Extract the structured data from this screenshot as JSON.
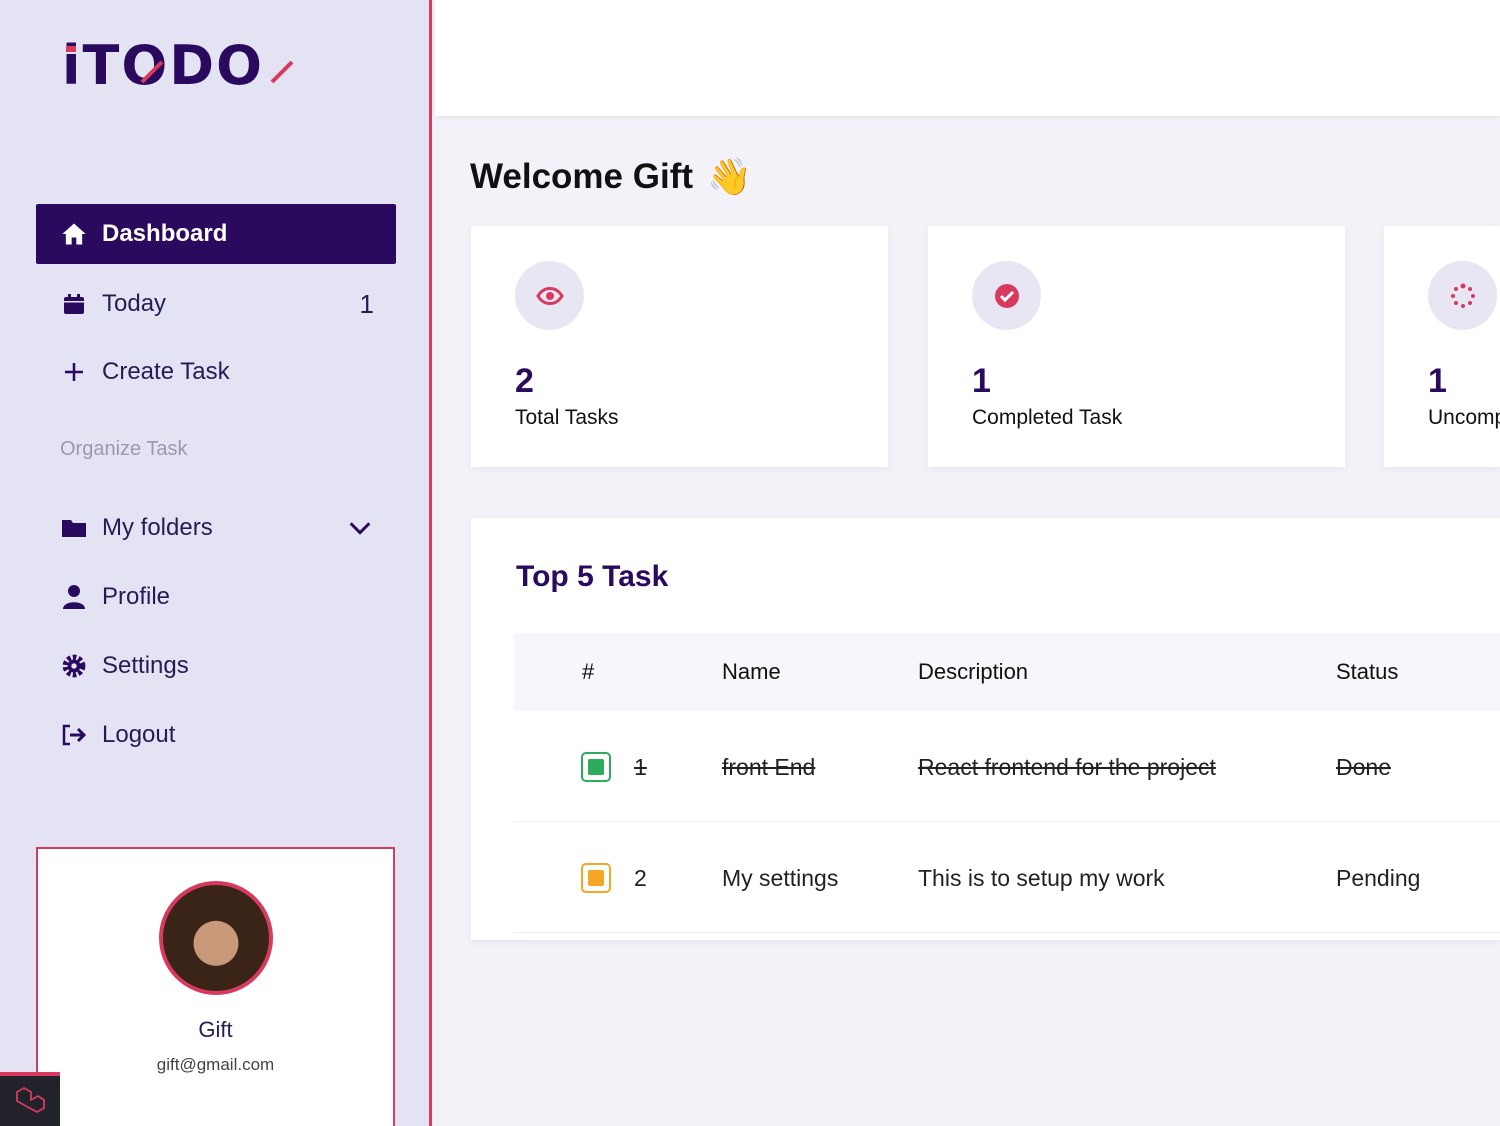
{
  "brand": {
    "logo_text": "iTODO"
  },
  "sidebar": {
    "items": [
      {
        "label": "Dashboard",
        "icon": "home-icon"
      },
      {
        "label": "Today",
        "icon": "calendar-icon",
        "badge": "1"
      },
      {
        "label": "Create Task",
        "icon": "plus-icon"
      },
      {
        "label": "My folders",
        "icon": "folder-icon"
      },
      {
        "label": "Profile",
        "icon": "user-icon"
      },
      {
        "label": "Settings",
        "icon": "gear-icon"
      },
      {
        "label": "Logout",
        "icon": "logout-icon"
      }
    ],
    "section_label": "Organize Task"
  },
  "user": {
    "name": "Gift",
    "email": "gift@gmail.com"
  },
  "main": {
    "welcome": "Welcome Gift",
    "welcome_emoji": "👋",
    "stats": [
      {
        "value": "2",
        "label": "Total Tasks",
        "icon": "eye-icon"
      },
      {
        "value": "1",
        "label": "Completed Task",
        "icon": "check-circle-icon"
      },
      {
        "value": "1",
        "label": "Uncomp",
        "icon": "spinner-icon"
      }
    ],
    "table": {
      "title": "Top 5 Task",
      "headers": [
        "#",
        "Name",
        "Description",
        "Status"
      ],
      "rows": [
        {
          "num": "1",
          "name": "front End",
          "description": "React frontend for the project",
          "status": "Done",
          "done": true,
          "color": "#2eaa5c"
        },
        {
          "num": "2",
          "name": "My settings",
          "description": "This is to setup my work",
          "status": "Pending",
          "done": false,
          "color": "#f5a623"
        }
      ]
    }
  },
  "colors": {
    "primary": "#2a0a5e",
    "accent": "#d63b5f",
    "sidebar_bg": "#e3e3f3"
  }
}
